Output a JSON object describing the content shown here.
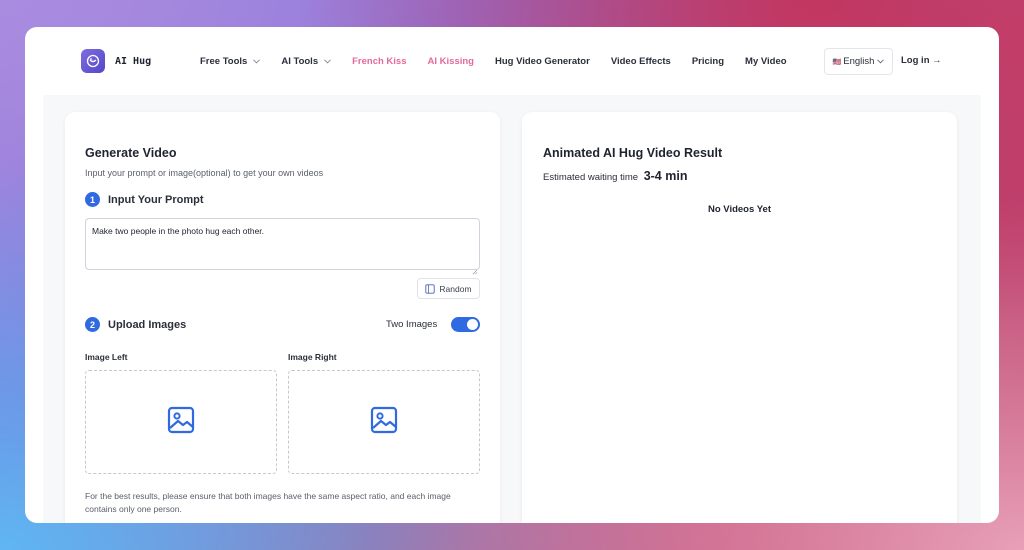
{
  "header": {
    "brand": "AI Hug",
    "nav": [
      {
        "label": "Free Tools",
        "dropdown": true,
        "accent": false
      },
      {
        "label": "AI Tools",
        "dropdown": true,
        "accent": false
      },
      {
        "label": "French Kiss",
        "dropdown": false,
        "accent": true
      },
      {
        "label": "AI Kissing",
        "dropdown": false,
        "accent": true
      },
      {
        "label": "Hug Video Generator",
        "dropdown": false,
        "accent": false
      },
      {
        "label": "Video Effects",
        "dropdown": false,
        "accent": false
      },
      {
        "label": "Pricing",
        "dropdown": false,
        "accent": false
      },
      {
        "label": "My Video",
        "dropdown": false,
        "accent": false
      }
    ],
    "language": {
      "flag": "🇺🇸",
      "label": "English"
    },
    "login": "Log in →"
  },
  "generator": {
    "title": "Generate Video",
    "subtitle": "Input your prompt or image(optional) to get your own videos",
    "step1": {
      "num": "1",
      "label": "Input Your Prompt"
    },
    "prompt_value": "Make two people in the photo hug each other.",
    "random_label": "Random",
    "step2": {
      "num": "2",
      "label": "Upload Images"
    },
    "two_images_label": "Two Images",
    "two_images_on": true,
    "image_left_label": "Image Left",
    "image_right_label": "Image Right",
    "note": "For the best results, please ensure that both images have the same aspect ratio, and each image contains only one person."
  },
  "result": {
    "title": "Animated AI Hug Video Result",
    "wait_label": "Estimated waiting time",
    "wait_value": "3-4 min",
    "empty_text": "No Videos Yet"
  },
  "colors": {
    "accent_blue": "#2f6ae0",
    "accent_pink": "#e26a9d",
    "brand_purple": "#5546c9"
  },
  "icons": {
    "logo": "hug-logo-icon",
    "chevron": "chevron-down-icon",
    "random": "shuffle-card-icon",
    "image_placeholder": "image-icon"
  }
}
